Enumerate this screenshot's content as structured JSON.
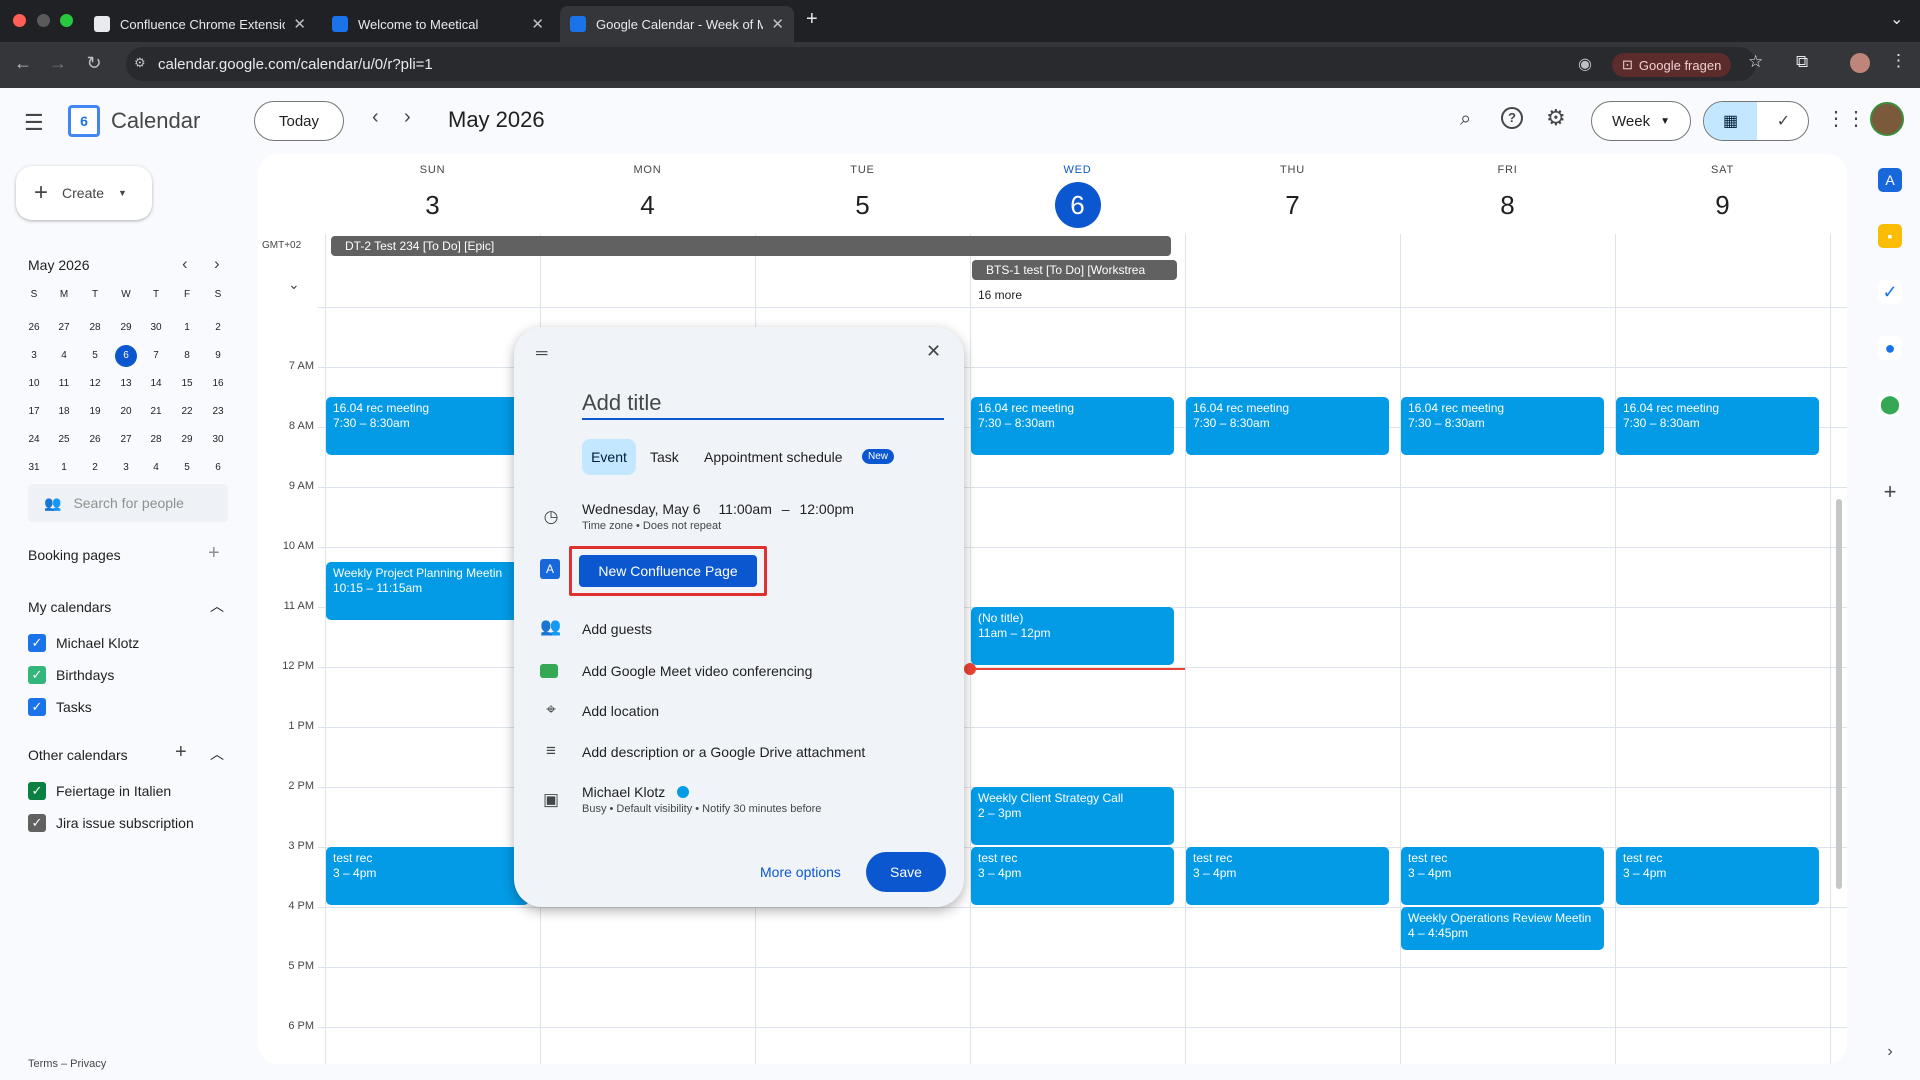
{
  "browser": {
    "tabs": [
      {
        "title": "Confluence Chrome Extensio",
        "fav_color": "#e8eaed"
      },
      {
        "title": "Welcome to Meetical",
        "fav_color": "#1a73e8"
      },
      {
        "title": "Google Calendar - Week of M",
        "fav_color": "#1a73e8"
      }
    ],
    "url": "calendar.google.com/calendar/u/0/r?pli=1",
    "google_fragen": "Google fragen"
  },
  "app": {
    "name": "Calendar",
    "logo_digit": "6",
    "today_label": "Today",
    "month_title": "May 2026",
    "view_label": "Week"
  },
  "sidebar": {
    "create_label": "Create",
    "mini_title": "May 2026",
    "weekday_initials": [
      "S",
      "M",
      "T",
      "W",
      "T",
      "F",
      "S"
    ],
    "weeks": [
      [
        "26",
        "27",
        "28",
        "29",
        "30",
        "1",
        "2"
      ],
      [
        "3",
        "4",
        "5",
        "6",
        "7",
        "8",
        "9"
      ],
      [
        "10",
        "11",
        "12",
        "13",
        "14",
        "15",
        "16"
      ],
      [
        "17",
        "18",
        "19",
        "20",
        "21",
        "22",
        "23"
      ],
      [
        "24",
        "25",
        "26",
        "27",
        "28",
        "29",
        "30"
      ],
      [
        "31",
        "1",
        "2",
        "3",
        "4",
        "5",
        "6"
      ]
    ],
    "search_people_placeholder": "Search for people",
    "booking_pages": "Booking pages",
    "my_calendars_title": "My calendars",
    "my_calendars": [
      {
        "name": "Michael Klotz",
        "color": "#1a73e8"
      },
      {
        "name": "Birthdays",
        "color": "#33b679"
      },
      {
        "name": "Tasks",
        "color": "#1a73e8"
      }
    ],
    "other_calendars_title": "Other calendars",
    "other_calendars": [
      {
        "name": "Feiertage in Italien",
        "color": "#0b8043"
      },
      {
        "name": "Jira issue subscription",
        "color": "#616161"
      }
    ],
    "footer": "Terms – Privacy"
  },
  "grid": {
    "timezone": "GMT+02",
    "days": [
      {
        "name": "SUN",
        "date": "3"
      },
      {
        "name": "MON",
        "date": "4"
      },
      {
        "name": "TUE",
        "date": "5"
      },
      {
        "name": "WED",
        "date": "6"
      },
      {
        "name": "THU",
        "date": "7"
      },
      {
        "name": "FRI",
        "date": "8"
      },
      {
        "name": "SAT",
        "date": "9"
      }
    ],
    "hours": [
      "6 AM",
      "7 AM",
      "8 AM",
      "9 AM",
      "10 AM",
      "11 AM",
      "12 PM",
      "1 PM",
      "2 PM",
      "3 PM",
      "4 PM",
      "5 PM",
      "6 PM"
    ],
    "allday": [
      {
        "title": "DT-2 Test 234 [To Do] [Epic]"
      },
      {
        "title": "BTS-1 test [To Do] [Workstrea"
      }
    ],
    "more": "16 more",
    "events": [
      {
        "title": "16.04 rec meeting",
        "time": "7:30 – 8:30am"
      },
      {
        "title": "16.04 rec meeting",
        "time": "7:30 – 8:30am"
      },
      {
        "title": "16.04 rec meeting",
        "time": "7:30 – 8:30am"
      },
      {
        "title": "16.04 rec meeting",
        "time": "7:30 – 8:30am"
      },
      {
        "title": "16.04 rec meeting",
        "time": "7:30 – 8:30am"
      },
      {
        "title": "Weekly Project Planning Meetin",
        "time": "10:15 – 11:15am"
      },
      {
        "title": "(No title)",
        "time": "11am – 12pm"
      },
      {
        "title": "Weekly Client Strategy Call",
        "time": "2 – 3pm"
      },
      {
        "title": "test rec",
        "time": "3 – 4pm"
      },
      {
        "title": "test rec",
        "time": "3 – 4pm"
      },
      {
        "title": "test rec",
        "time": "3 – 4pm"
      },
      {
        "title": "test rec",
        "time": "3 – 4pm"
      },
      {
        "title": "test rec",
        "time": "3 – 4pm"
      },
      {
        "title": "Weekly Operations Review Meetin",
        "time": "4 – 4:45pm"
      }
    ]
  },
  "dialog": {
    "title_placeholder": "Add title",
    "tabs": {
      "event": "Event",
      "task": "Task",
      "appointment": "Appointment schedule",
      "new_badge": "New"
    },
    "datetime": {
      "date": "Wednesday, May 6",
      "start": "11:00am",
      "dash": "–",
      "end": "12:00pm",
      "sub": "Time zone • Does not repeat"
    },
    "confluence_button": "New Confluence Page",
    "add_guests": "Add guests",
    "add_meet": "Add Google Meet video conferencing",
    "add_location": "Add location",
    "add_description": "Add description or a Google Drive attachment",
    "owner": "Michael Klotz",
    "owner_sub": "Busy • Default visibility • Notify 30 minutes before",
    "more_options": "More options",
    "save": "Save"
  }
}
